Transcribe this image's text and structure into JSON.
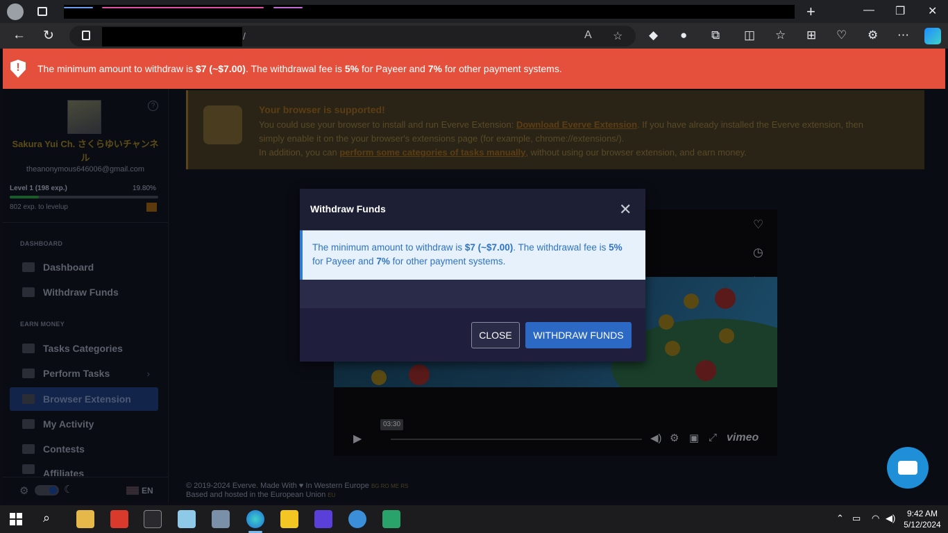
{
  "browser": {
    "url_suffix": "/",
    "tab_colors": [
      "#6a9cf0",
      "#e04fa8",
      "#c36bd8"
    ]
  },
  "alert": {
    "icon": "shield-exclamation-icon",
    "text_1": "The minimum amount to withdraw is ",
    "min_amount": "$7 (~$7.00)",
    "text_2": ". The withdrawal fee is ",
    "fee_payeer": "5%",
    "text_3": " for Payeer and ",
    "fee_other": "7%",
    "text_4": " for other payment systems.",
    "color": "#e4503c"
  },
  "sidebar": {
    "user_name": "Sakura Yui Ch. さくらゆいチャンネル",
    "email": "theanonymous646006@gmail.com",
    "level_label": "Level 1 (198 exp.)",
    "level_percent": "19.80%",
    "level_progress": 0.198,
    "levelup_text": "802 exp. to levelup",
    "sections": [
      {
        "title": "DASHBOARD",
        "items": [
          {
            "label": "Dashboard",
            "icon": "dashboard-icon"
          },
          {
            "label": "Withdraw Funds",
            "icon": "wallet-icon"
          }
        ]
      },
      {
        "title": "EARN MONEY",
        "items": [
          {
            "label": "Tasks Categories",
            "icon": "tag-icon"
          },
          {
            "label": "Perform Tasks",
            "icon": "thumbs-up-icon"
          },
          {
            "label": "Browser Extension",
            "icon": "puzzle-icon"
          },
          {
            "label": "My Activity",
            "icon": "lightning-icon"
          },
          {
            "label": "Contests",
            "icon": "calendar-icon"
          },
          {
            "label": "Affiliates",
            "icon": "users-icon"
          }
        ]
      }
    ],
    "language": "EN"
  },
  "notice": {
    "title": "Your browser is supported!",
    "line1_pre": "You could use your browser to install and run Everve Extension: ",
    "line1_link": "Download Everve Extension",
    "line1_post": ". If you have already installed the Everve extension, then",
    "line2": "simply enable it on the your browser's extensions page (for example, chrome://extensions/).",
    "line3_pre": "In addition, you can ",
    "line3_link": "perform some categories of tasks manually",
    "line3_post": ", without using our browser extension, and earn money."
  },
  "video": {
    "time": "03:30",
    "brand": "vimeo"
  },
  "footer": {
    "line1": "© 2019-2024 Everve. Made With ♥ In Western Europe",
    "line1_tags": "BG RO ME RS",
    "line2": "Based and hosted in the European Union",
    "line2_tag": "EU"
  },
  "modal": {
    "title": "Withdraw Funds",
    "info_1": "The minimum amount to withdraw is ",
    "info_min": "$7 (~$7.00)",
    "info_2": ". The withdrawal fee is ",
    "info_fee_payeer": "5%",
    "info_3": " for Payeer and ",
    "info_fee_other": "7%",
    "info_4": " for other payment systems.",
    "close_label": "CLOSE",
    "withdraw_label": "WITHDRAW FUNDS",
    "accent": "#2b69c5"
  },
  "taskbar": {
    "time": "9:42 AM",
    "date": "5/12/2024"
  }
}
